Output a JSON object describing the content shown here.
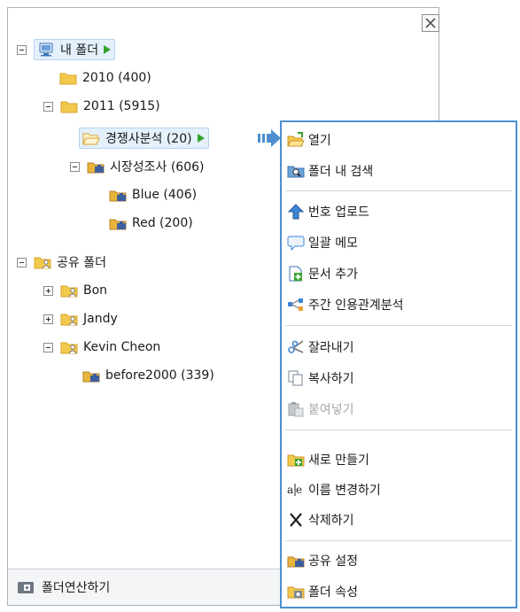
{
  "tree": {
    "my_folder": "내 폴더",
    "y2010": "2010 (400)",
    "y2011": "2011 (5915)",
    "competitor": "경쟁사분석 (20)",
    "market": "시장성조사 (606)",
    "blue": "Blue (406)",
    "red": "Red (200)",
    "shared": "공유 폴더",
    "bon": "Bon",
    "jandy": "Jandy",
    "kevin": "Kevin Cheon",
    "before2000": "before2000 (339)"
  },
  "bottom": {
    "label": "폴더연산하기"
  },
  "menu": {
    "open": "열기",
    "search_in_folder": "폴더 내 검색",
    "number_upload": "번호 업로드",
    "batch_memo": "일괄 메모",
    "add_document": "문서 추가",
    "citation_analysis": "주간 인용관계분석",
    "cut": "잘라내기",
    "copy": "복사하기",
    "paste": "붙여넣기",
    "new_folder": "새로 만들기",
    "rename": "이름 변경하기",
    "delete": "삭제하기",
    "share_settings": "공유 설정",
    "folder_properties": "폴더 속성"
  },
  "colors": {
    "accent": "#4d8fcf",
    "folder": "#f2c94c",
    "play": "#35a32a"
  }
}
